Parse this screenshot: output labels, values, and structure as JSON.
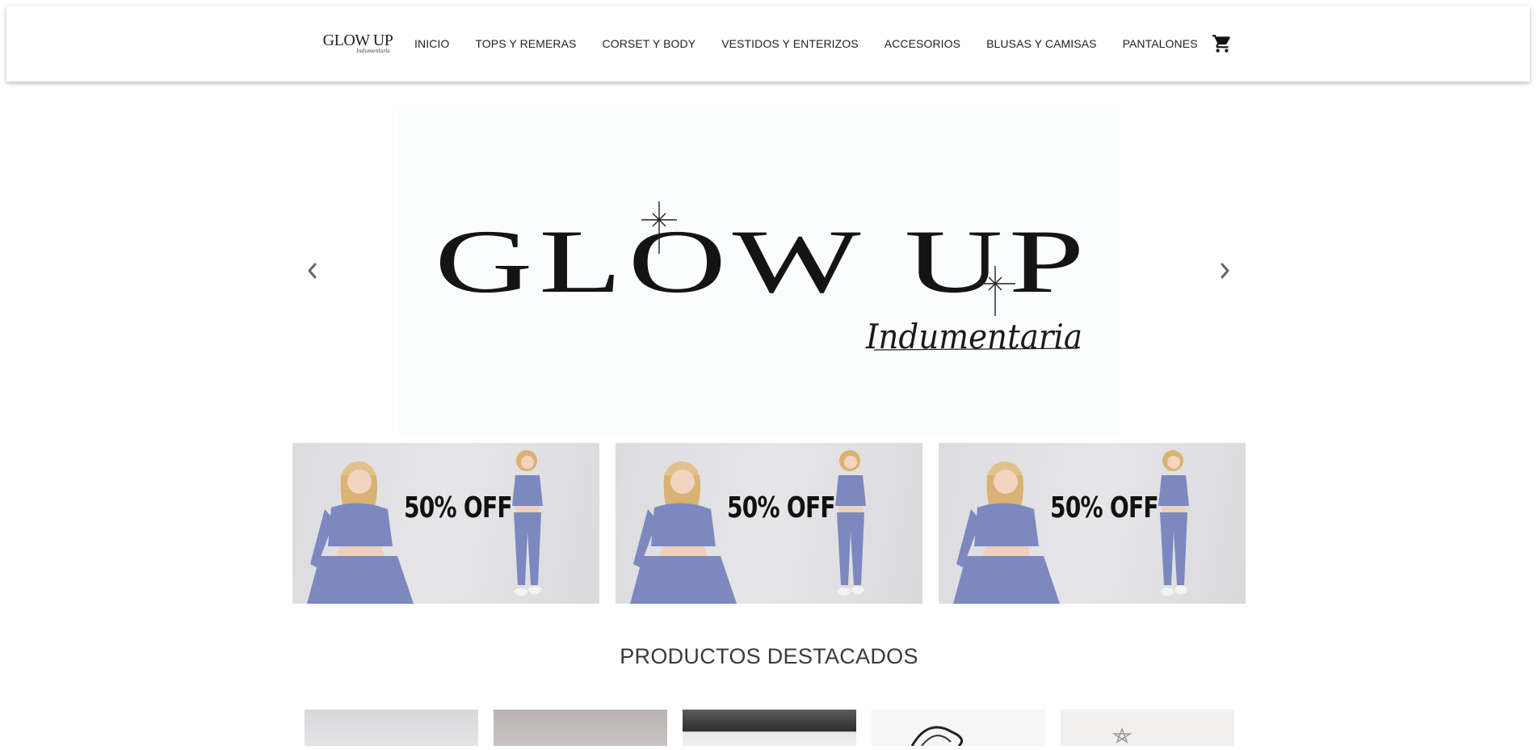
{
  "header": {
    "logo": {
      "main": "GLOW UP",
      "sub": "Indumentaria"
    },
    "nav": [
      {
        "label": "INICIO"
      },
      {
        "label": "TOPS Y REMERAS"
      },
      {
        "label": "CORSET Y BODY"
      },
      {
        "label": "VESTIDOS Y ENTERIZOS"
      },
      {
        "label": "ACCESORIOS"
      },
      {
        "label": "BLUSAS Y CAMISAS"
      },
      {
        "label": "PANTALONES"
      }
    ],
    "cart_icon": "shopping-cart-icon"
  },
  "hero": {
    "brand": "GLOW UP",
    "tagline": "Indumentaria",
    "prev_icon": "chevron-left-icon",
    "next_icon": "chevron-right-icon"
  },
  "promos": [
    {
      "text": "50% OFF"
    },
    {
      "text": "50% OFF"
    },
    {
      "text": "50% OFF"
    }
  ],
  "featured": {
    "title": "PRODUCTOS DESTACADOS"
  },
  "colors": {
    "text": "#222222",
    "outfit": "#7c88bf",
    "hero_bg": "#fbfcfe"
  }
}
